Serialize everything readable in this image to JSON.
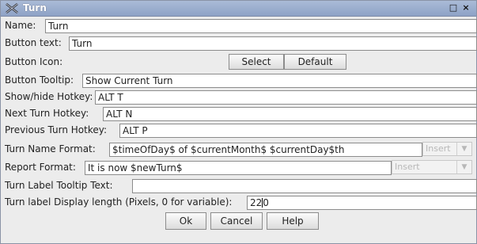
{
  "window": {
    "title": "Turn",
    "minimize_glyph": "□",
    "close_glyph": "×"
  },
  "fields": {
    "name": {
      "label": "Name:",
      "value": "Turn"
    },
    "button_text": {
      "label": "Button text:",
      "value": "Turn"
    },
    "button_icon": {
      "label": "Button Icon:",
      "select_label": "Select",
      "default_label": "Default"
    },
    "button_tooltip": {
      "label": "Button Tooltip:",
      "value": "Show Current Turn"
    },
    "show_hide_hotkey": {
      "label": "Show/hide Hotkey:",
      "value": "ALT T"
    },
    "next_turn_hotkey": {
      "label": "Next Turn Hotkey:",
      "value": "ALT N"
    },
    "previous_turn_hotkey": {
      "label": "Previous Turn Hotkey:",
      "value": "ALT P"
    },
    "turn_name_format": {
      "label": "Turn Name Format:",
      "value": "$timeOfDay$ of $currentMonth$ $currentDay$th",
      "insert_label": "Insert"
    },
    "report_format": {
      "label": "Report Format:",
      "value": "It is now $newTurn$",
      "insert_label": "Insert"
    },
    "turn_label_tooltip_text": {
      "label": "Turn Label Tooltip Text:",
      "value": ""
    },
    "turn_label_display_length": {
      "label": "Turn label Display length (Pixels, 0 for variable):",
      "value_before_caret": "22",
      "value_after_caret": "0"
    }
  },
  "buttons": {
    "ok": "Ok",
    "cancel": "Cancel",
    "help": "Help"
  },
  "colors": {
    "titlebar": "#8ea2c6",
    "background": "#ececec"
  }
}
